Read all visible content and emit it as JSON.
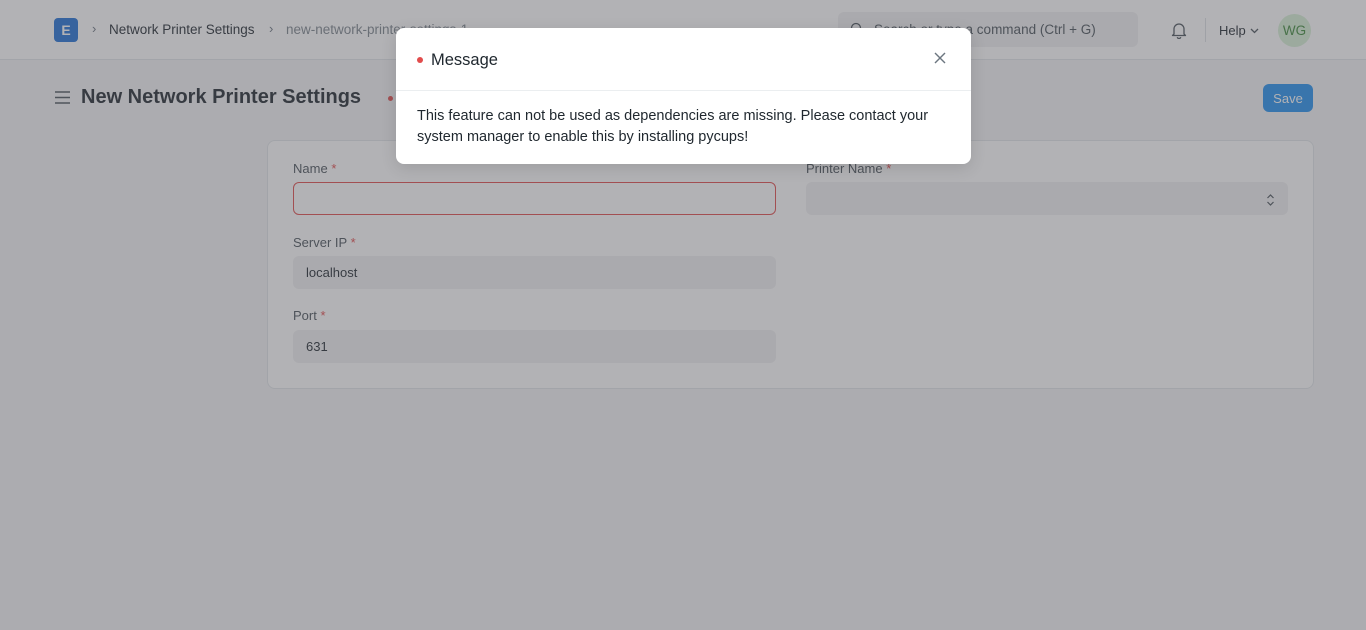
{
  "navbar": {
    "logo_letter": "E",
    "breadcrumbs": [
      "Network Printer Settings",
      "new-network-printer-settings-1"
    ],
    "search_placeholder": "Search or type a command (Ctrl + G)",
    "help_label": "Help",
    "avatar_initials": "WG",
    "icons": {
      "search": "search-icon",
      "notifications": "bell-icon",
      "help_dropdown": "chevron-down-icon"
    }
  },
  "page": {
    "title": "New Network Printer Settings",
    "save_label": "Save",
    "status": "not-saved-indicator"
  },
  "form": {
    "fields": [
      {
        "label": "Name",
        "required": "*",
        "value": ""
      },
      {
        "label": "Printer Name",
        "required": "*",
        "value": ""
      },
      {
        "label": "Server IP",
        "required": "*",
        "value": "localhost"
      },
      {
        "label": "Port",
        "required": "*",
        "value": "631"
      }
    ]
  },
  "modal": {
    "title": "Message",
    "body": "This feature can not be used as dependencies are missing. Please contact your system manager to enable this by installing pycups!",
    "indicator_color": "#e24c4c"
  },
  "colors": {
    "accent": "#2490ef",
    "error": "#e24c4c",
    "logo": "#1f6fd6"
  }
}
